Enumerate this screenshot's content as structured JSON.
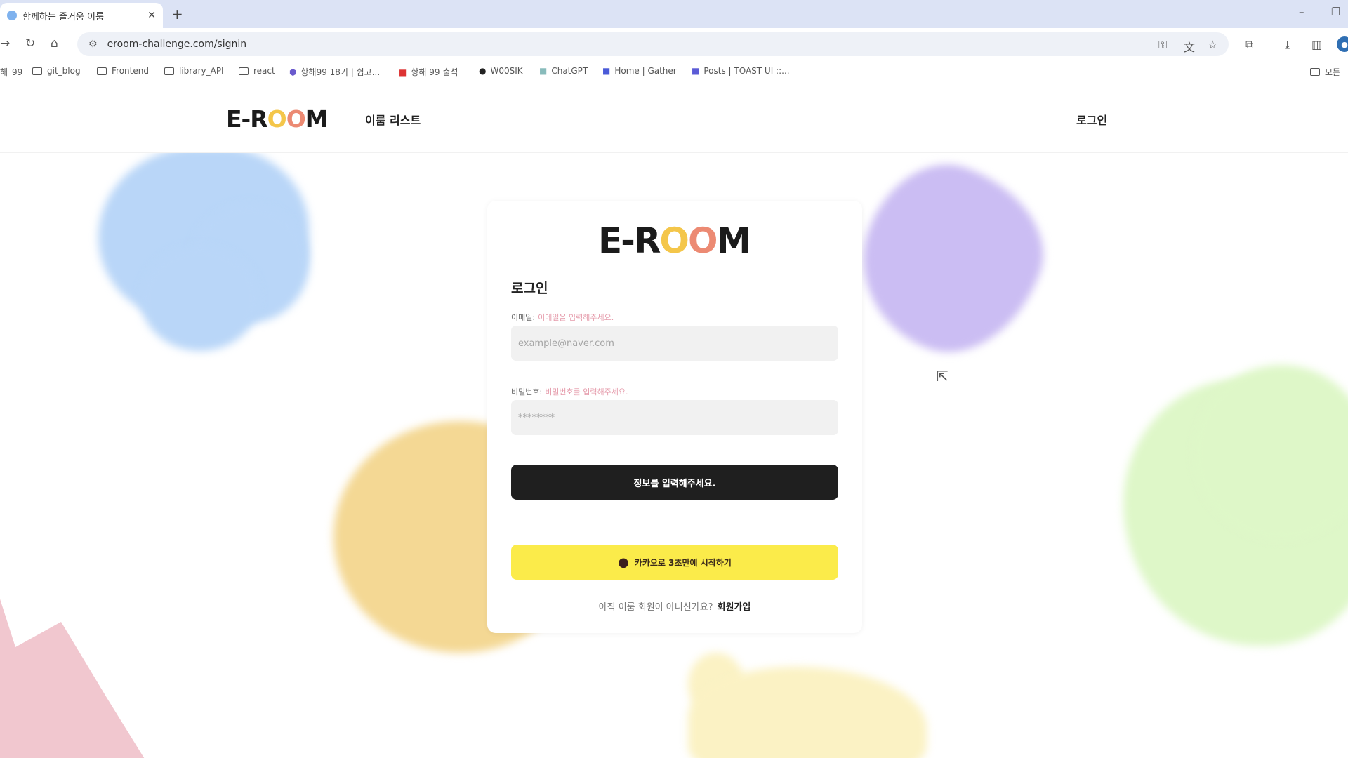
{
  "browser": {
    "tab_title": "함께하는 즐거움 이룸",
    "new_tab": "+",
    "url": "eroom-challenge.com/signin",
    "bookmarks": [
      {
        "label": "99"
      },
      {
        "label": "git_blog"
      },
      {
        "label": "Frontend"
      },
      {
        "label": "library_API"
      },
      {
        "label": "react"
      },
      {
        "label": "항해99 18기 | 쉽고..."
      },
      {
        "label": "항해 99 출석"
      },
      {
        "label": "W00SIK"
      },
      {
        "label": "ChatGPT"
      },
      {
        "label": "Home | Gather"
      },
      {
        "label": "Posts | TOAST UI ::..."
      }
    ],
    "all_bookmarks": "모든"
  },
  "header": {
    "logo_prefix": "E-R",
    "logo_o1": "O",
    "logo_o2": "O",
    "logo_suffix": "M",
    "nav_room_list": "이룸 리스트",
    "nav_login": "로그인"
  },
  "login": {
    "logo_prefix": "E-R",
    "logo_o1": "O",
    "logo_o2": "O",
    "logo_suffix": "M",
    "title": "로그인",
    "email_label": "이메일:",
    "email_hint": "이메일을 입력해주세요.",
    "email_placeholder": "example@naver.com",
    "password_label": "비밀번호:",
    "password_hint": "비밀번호를 입력해주세요.",
    "password_placeholder": "********",
    "submit_label": "정보를 입력해주세요.",
    "kakao_label": "카카오로 3초만에 시작하기",
    "signup_prompt": "아직 이룸 회원이 아니신가요?",
    "signup_link": "회원가입"
  },
  "colors": {
    "kakao_yellow": "#fbeb4a",
    "submit_dark": "#1f1f1f",
    "hint_pink": "#e59aaa"
  }
}
